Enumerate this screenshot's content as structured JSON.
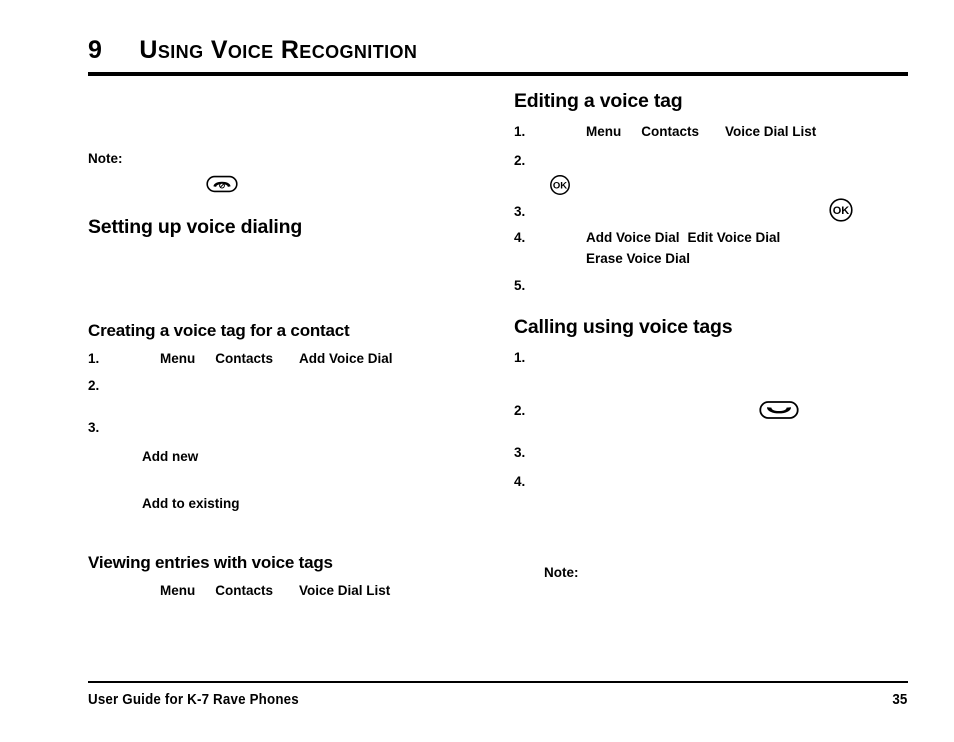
{
  "header": {
    "chapter_number": "9",
    "chapter_title": "Using Voice Recognition"
  },
  "left_column": {
    "note_label": "Note:",
    "end_call_icon": "end-call-key-icon",
    "setting_up_heading": "Setting up voice dialing",
    "creating_heading": "Creating a voice tag for a contact",
    "creating_steps": [
      {
        "number": "1.",
        "terms": [
          "Menu",
          "Contacts",
          "Add Voice Dial"
        ]
      },
      {
        "number": "2.",
        "terms": []
      },
      {
        "number": "3.",
        "terms": []
      }
    ],
    "creating_options": [
      "Add new",
      "Add to existing"
    ],
    "viewing_heading": "Viewing entries with voice tags",
    "viewing_path": [
      "Menu",
      "Contacts",
      "Voice Dial List"
    ]
  },
  "right_column": {
    "editing_heading": "Editing a voice tag",
    "editing_steps": [
      {
        "number": "1.",
        "terms": [
          "Menu",
          "Contacts",
          "Voice Dial List"
        ]
      },
      {
        "number": "2.",
        "terms": []
      },
      {
        "number": "3.",
        "terms": []
      },
      {
        "number": "4.",
        "terms": [
          "Add Voice Dial",
          "Edit Voice Dial",
          "Erase Voice Dial"
        ]
      },
      {
        "number": "5.",
        "terms": []
      }
    ],
    "ok_icon": "ok-key-icon",
    "calling_heading": "Calling using voice tags",
    "calling_steps": [
      {
        "number": "1."
      },
      {
        "number": "2."
      },
      {
        "number": "3."
      },
      {
        "number": "4."
      }
    ],
    "send_icon": "send-key-icon",
    "note_label": "Note:"
  },
  "footer": {
    "text": "User Guide for K-7 Rave Phones",
    "page_number": "35"
  }
}
